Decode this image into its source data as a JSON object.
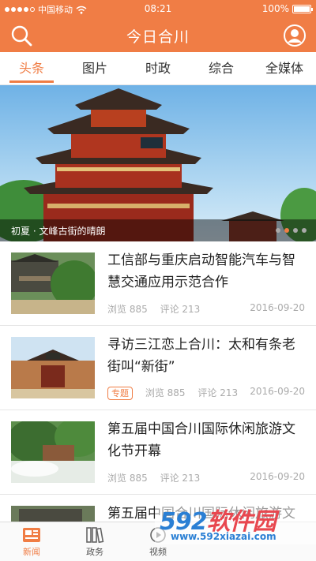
{
  "status_bar": {
    "carrier": "中国移动",
    "time": "08:21",
    "battery": "100%"
  },
  "header": {
    "title": "今日合川"
  },
  "tabs": [
    {
      "label": "头条",
      "active": true
    },
    {
      "label": "图片",
      "active": false
    },
    {
      "label": "时政",
      "active": false
    },
    {
      "label": "综合",
      "active": false
    },
    {
      "label": "全媒体",
      "active": false
    }
  ],
  "hero": {
    "caption": "初夏 · 文峰古街的晴朗",
    "pages": 4,
    "current_page": 1
  },
  "news": [
    {
      "title": "工信部与重庆启动智能汽车与智慧交通应用示范合作",
      "tag": "",
      "views": "浏览 885",
      "comments": "评论 213",
      "date": "2016-09-20"
    },
    {
      "title": "寻访三江恋上合川：太和有条老街叫“新街”",
      "tag": "专题",
      "views": "浏览 885",
      "comments": "评论 213",
      "date": "2016-09-20"
    },
    {
      "title": "第五届中国合川国际休闲旅游文化节开幕",
      "tag": "",
      "views": "浏览 885",
      "comments": "评论 213",
      "date": "2016-09-20"
    },
    {
      "title": "第五届中国合川国际休闲旅游文",
      "tag": "",
      "views": "",
      "comments": "",
      "date": ""
    }
  ],
  "bottom_nav": [
    {
      "label": "新闻",
      "icon": "newspaper-icon",
      "active": true
    },
    {
      "label": "政务",
      "icon": "books-icon",
      "active": false
    },
    {
      "label": "视频",
      "icon": "play-icon",
      "active": false
    }
  ],
  "watermark": {
    "brand_num": "592",
    "brand_text": "软件园",
    "url": "www.592xiazai.com"
  },
  "colors": {
    "accent": "#f07d45",
    "meta_gray": "#aaaaaa"
  }
}
